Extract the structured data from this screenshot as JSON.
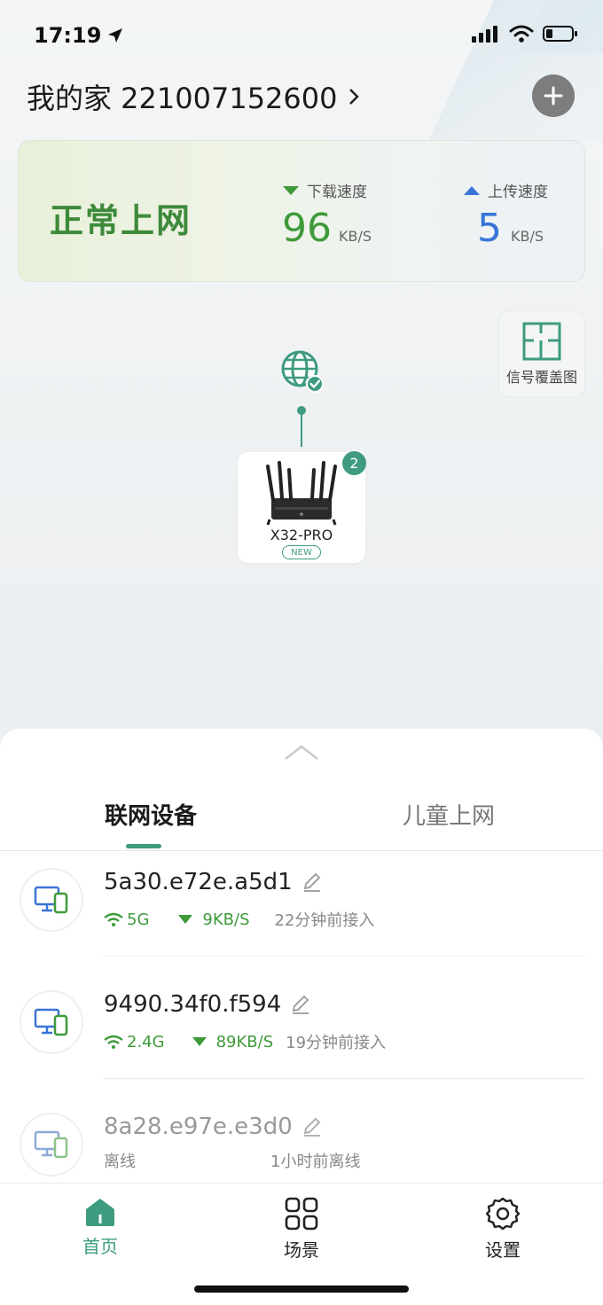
{
  "status_bar": {
    "time": "17:19"
  },
  "header": {
    "home_title": "我的家 221007152600"
  },
  "network": {
    "status": "正常上网",
    "download": {
      "label": "下载速度",
      "value": "96",
      "unit": "KB/S"
    },
    "upload": {
      "label": "上传速度",
      "value": "5",
      "unit": "KB/S"
    }
  },
  "coverage": {
    "label": "信号覆盖图"
  },
  "router": {
    "name": "X32-PRO",
    "badge": "NEW",
    "count": "2"
  },
  "tabs": [
    {
      "label": "联网设备",
      "active": true
    },
    {
      "label": "儿童上网",
      "active": false
    }
  ],
  "devices": [
    {
      "name": "5a30.e72e.a5d1",
      "band": "5G",
      "speed": "9KB/S",
      "time": "22分钟前接入",
      "online": true
    },
    {
      "name": "9490.34f0.f594",
      "band": "2.4G",
      "speed": "89KB/S",
      "time": "19分钟前接入",
      "online": true
    },
    {
      "name": "8a28.e97e.e3d0",
      "status": "离线",
      "time": "1小时前离线",
      "online": false
    }
  ],
  "nav": [
    {
      "label": "首页",
      "active": true,
      "icon": "home-icon"
    },
    {
      "label": "场景",
      "active": false,
      "icon": "grid-icon"
    },
    {
      "label": "设置",
      "active": false,
      "icon": "gear-icon"
    }
  ],
  "colors": {
    "accent": "#3e9b80",
    "online_green": "#3e9b3a",
    "status_green": "#3d8a3a",
    "upload_blue": "#3a74d6"
  }
}
